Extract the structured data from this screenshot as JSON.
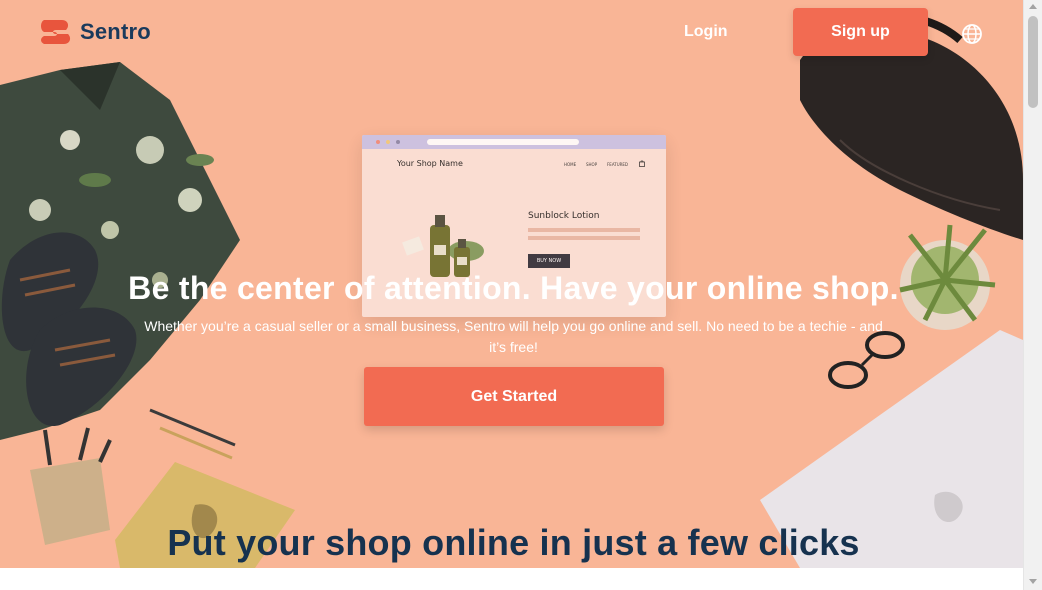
{
  "brand": {
    "name": "Sentro",
    "accent": "#f26b52",
    "navy": "#1a3a5c",
    "background": "#f9b596"
  },
  "header": {
    "login_label": "Login",
    "signup_label": "Sign up",
    "language_icon": "globe-icon"
  },
  "mockup": {
    "shop_name": "Your Shop Name",
    "nav": [
      "HOME",
      "SHOP",
      "FEATURED"
    ],
    "product_name": "Sunblock Lotion",
    "buy_label": "BUY NOW",
    "cart_icon": "bag-icon"
  },
  "hero": {
    "title": "Be the center of attention. Have your online shop.",
    "subtitle": "Whether you’re a casual seller or a small business, Sentro will help you go online and sell. No need to be a techie - and it’s free!",
    "cta_label": "Get Started"
  },
  "section": {
    "title": "Put your shop online in just a few clicks"
  }
}
